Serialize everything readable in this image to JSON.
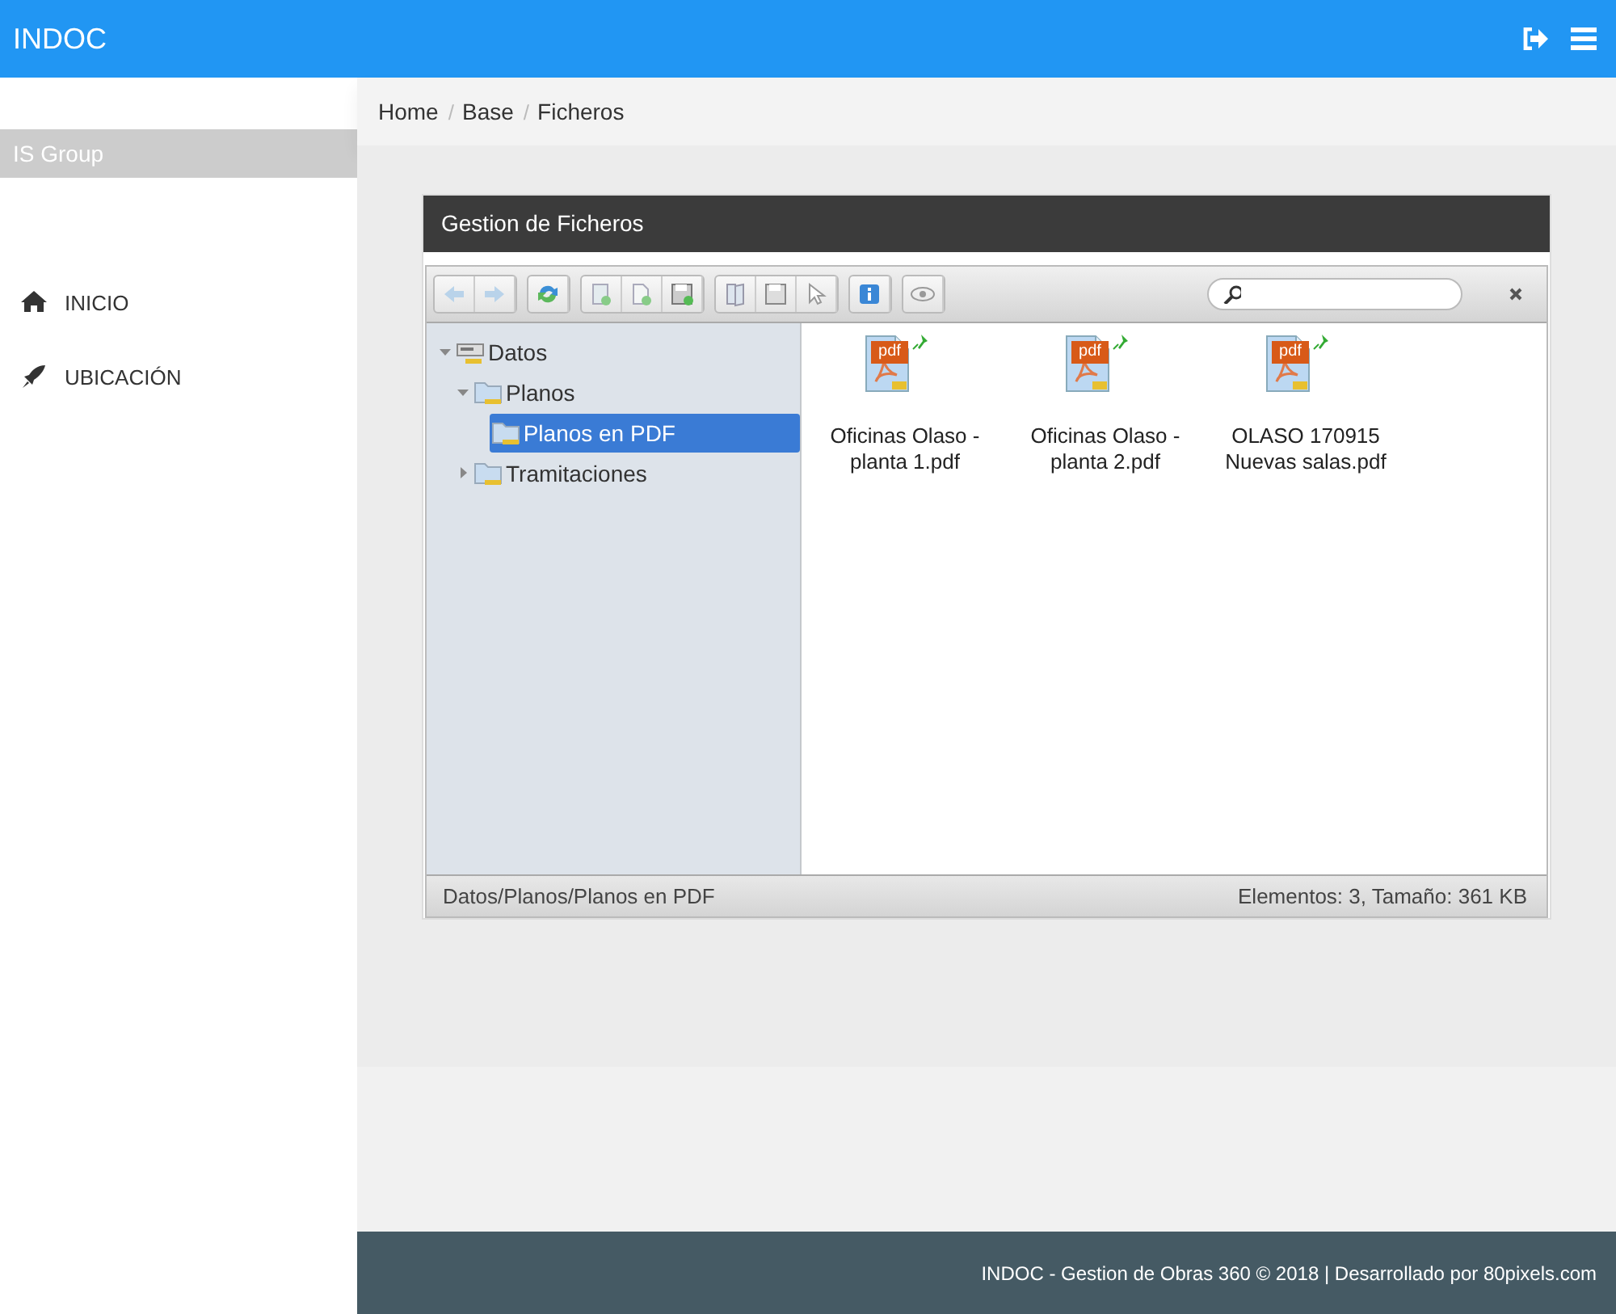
{
  "header": {
    "title": "INDOC"
  },
  "sidebar": {
    "company": "IS Group",
    "items": [
      {
        "kind": "home",
        "label": "INICIO"
      },
      {
        "kind": "rocket",
        "label": "UBICACIÓN"
      }
    ]
  },
  "breadcrumb": [
    {
      "label": "Home",
      "separator": "/"
    },
    {
      "label": "Base",
      "separator": "/"
    },
    {
      "label": "Ficheros"
    }
  ],
  "panel": {
    "title": "Gestion de Ficheros"
  },
  "tree": [
    {
      "label": "Datos",
      "kind": "drive",
      "expanded": true,
      "selected": false,
      "children": [
        {
          "label": "Planos",
          "kind": "folder",
          "expanded": true,
          "selected": false,
          "children": [
            {
              "label": "Planos en PDF",
              "kind": "folder",
              "selected": true
            }
          ]
        },
        {
          "label": "Tramitaciones",
          "kind": "folder",
          "expanded": false,
          "selected": false
        }
      ]
    }
  ],
  "files": [
    {
      "badge": "pdf",
      "name": "Oficinas Olaso - planta 1.pdf"
    },
    {
      "badge": "pdf",
      "name": "Oficinas Olaso - planta 2.pdf"
    },
    {
      "badge": "pdf",
      "name": "OLASO 170915 Nuevas salas.pdf"
    }
  ],
  "status_bar": {
    "path": "Datos/Planos/Planos en PDF",
    "summary": "Elementos: 3, Tamaño: 361 KB"
  },
  "footer": "INDOC - Gestion de Obras 360 © 2018 | Desarrollado por 80pixels.com"
}
